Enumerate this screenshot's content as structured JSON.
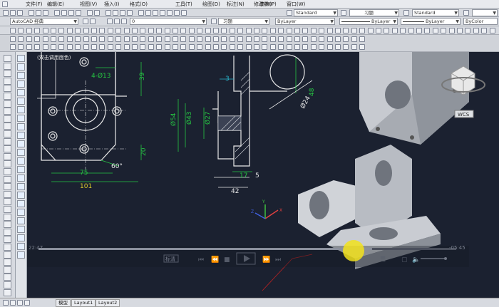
{
  "menubar": {
    "items": [
      "文件(F)",
      "编辑(E)",
      "视图(V)",
      "插入(I)",
      "格式(O)",
      "工具(T)",
      "绘图(D)",
      "标注(N)",
      "修改(M)",
      "参数(P)",
      "窗口(W)"
    ],
    "text_style": "Standard",
    "dim_label": "习题",
    "dim_style": "Standard"
  },
  "toolbar2": {
    "workspace": "AutoCAD 经典",
    "layer": "0",
    "layer_right": "习题",
    "color": "ByLayer",
    "linetype": "ByLayer",
    "lineweight": "ByLayer",
    "plotstyle": "ByColor"
  },
  "drawing": {
    "note": "4-Ø13",
    "note2": "(双击调用面色)",
    "dims": {
      "d39": "39",
      "d20": "20",
      "d75": "75",
      "d101": "101",
      "d60": "60°",
      "d3": "3",
      "d54": "Ø54",
      "d43": "Ø43",
      "d27": "Ø27",
      "d48": "48",
      "d24": "Ø24",
      "d17": "17",
      "d5": "5",
      "d42": "42"
    },
    "ucs": {
      "x": "X",
      "y": "Y",
      "z": "Z"
    },
    "viewcube_label": "WCS"
  },
  "video": {
    "time_current": "22:47",
    "time_total": "-05:45",
    "quality_label": "标清"
  },
  "layout_tabs": [
    "模型",
    "Layout1",
    "Layout2"
  ],
  "colors": {
    "background": "#1b2130",
    "green_dim": "#26c443",
    "cyan_dim": "#29b2c8",
    "yellow_dim": "#d8c82a",
    "white_line": "#e8e8e8",
    "hatch": "#cfd2d8"
  }
}
